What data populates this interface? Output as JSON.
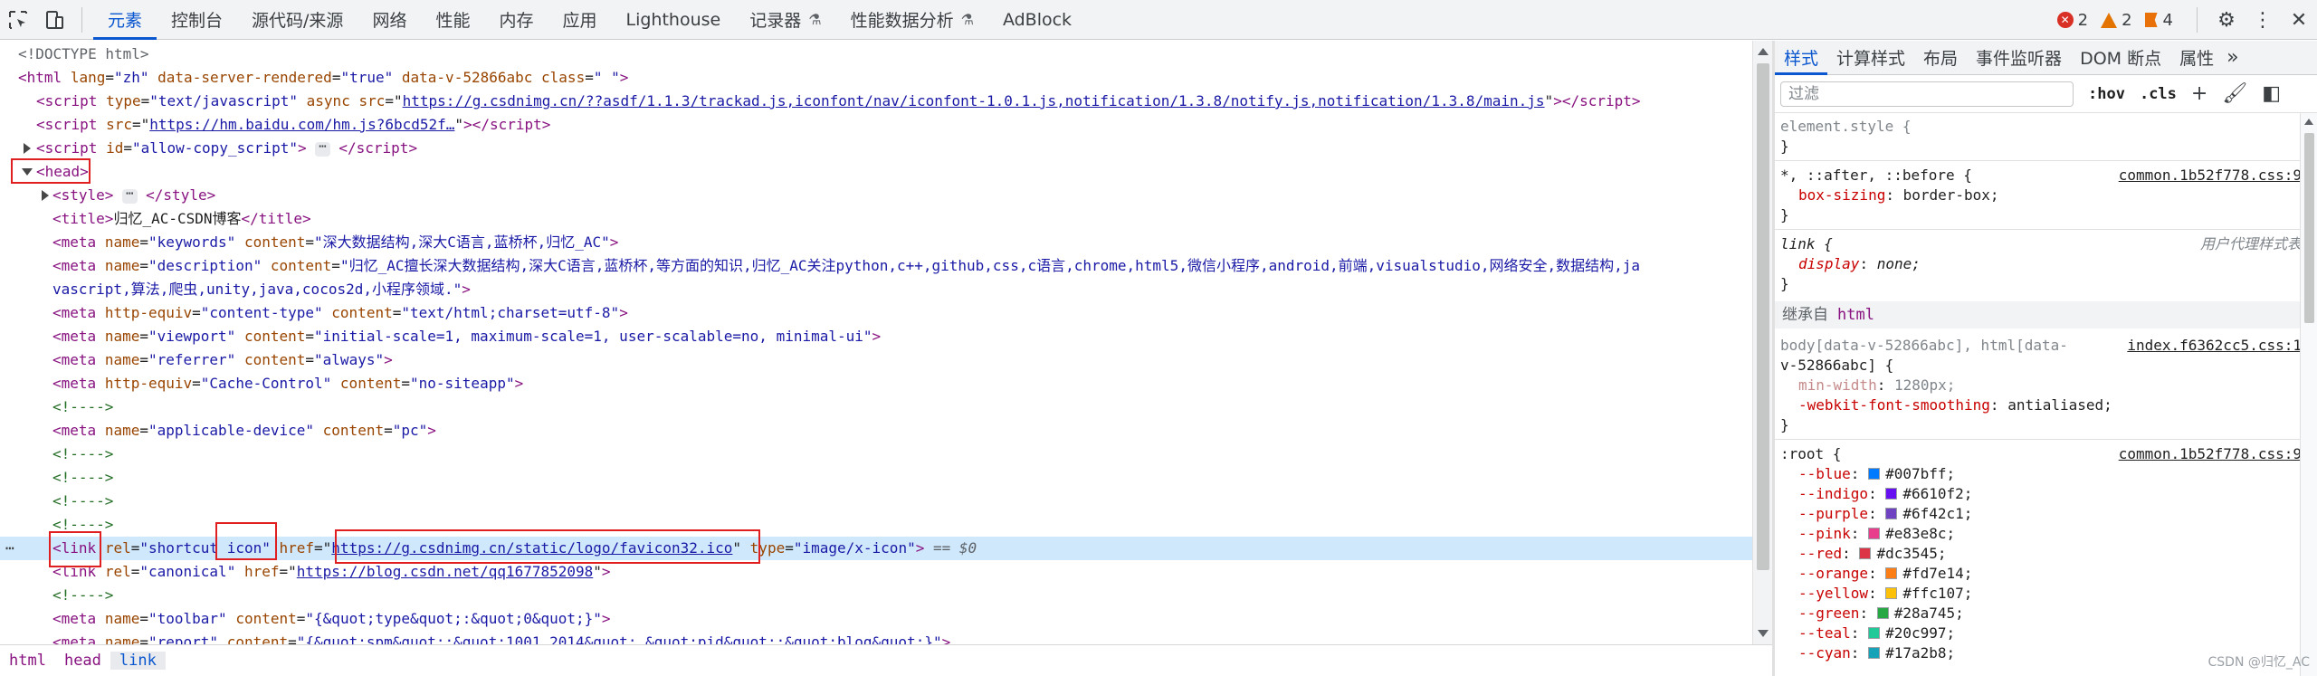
{
  "toolbar": {
    "tabs": [
      "元素",
      "控制台",
      "源代码/来源",
      "网络",
      "性能",
      "内存",
      "应用",
      "Lighthouse",
      "记录器",
      "性能数据分析",
      "AdBlock"
    ],
    "flask_symbol": "⚗",
    "errors": "2",
    "warnings": "2",
    "issues": "4"
  },
  "dom": {
    "l0": "<!DOCTYPE html>",
    "l1_tag": "<html",
    "l1_a1": "lang",
    "l1_v1": "\"zh\"",
    "l1_a2": "data-server-rendered",
    "l1_v2": "\"true\"",
    "l1_a3": "data-v-52866abc",
    "l1_a4": "class",
    "l1_v4": "\" \"",
    "l2_a1": "type",
    "l2_v1": "\"text/javascript\"",
    "l2_a2": "async",
    "l2_a3": "src",
    "l2_url": "https://g.csdnimg.cn/??asdf/1.1.3/trackad.js,iconfont/nav/iconfont-1.0.1.js,notification/1.3.8/notify.js,notification/1.3.8/main.js",
    "l3_url": "https://hm.baidu.com/hm.js?6bcd52f…",
    "l4_a1": "id",
    "l4_v1": "\"allow-copy_script\"",
    "head": "<head>",
    "title_text": "归忆_AC-CSDN博客",
    "kw_name": "\"keywords\"",
    "kw_content": "\"深大数据结构,深大C语言,蓝桥杯,归忆_AC\"",
    "desc_name": "\"description\"",
    "desc_content_1": "\"归忆_AC擅长深大数据结构,深大C语言,蓝桥杯,等方面的知识,归忆_AC关注python,c++,github,css,c语言,chrome,html5,微信小程序,android,前端,visualstudio,网络安全,数据结构,ja",
    "desc_content_2": "vascript,算法,爬虫,unity,java,cocos2d,小程序领域.\"",
    "ct_equiv": "\"content-type\"",
    "ct_content": "\"text/html;charset=utf-8\"",
    "vp_name": "\"viewport\"",
    "vp_content": "\"initial-scale=1, maximum-scale=1, user-scalable=no, minimal-ui\"",
    "ref_name": "\"referrer\"",
    "ref_content": "\"always\"",
    "cc_equiv": "\"Cache-Control\"",
    "cc_content": "\"no-siteapp\"",
    "comment": "<!---->",
    "ad_name": "\"applicable-device\"",
    "ad_content": "\"pc\"",
    "link_rel": "\"shortcut icon\"",
    "link_href": "https://g.csdnimg.cn/static/logo/favicon32.ico",
    "link_type": "\"image/x-icon\"",
    "eq0": "== $0",
    "canon_rel": "\"canonical\"",
    "canon_href": "https://blog.csdn.net/qq1677852098",
    "tb_name": "\"toolbar\"",
    "tb_content": "\"{&quot;type&quot;:&quot;0&quot;}\"",
    "rp_name": "\"report\"",
    "rp_content": "\"{&quot;spm&quot;:&quot;1001.2014&quot;,&quot;pid&quot;:&quot;blog&quot;}\""
  },
  "breadcrumb": [
    "html",
    "head",
    "link"
  ],
  "styles": {
    "tabs": [
      "样式",
      "计算样式",
      "布局",
      "事件监听器",
      "DOM 断点",
      "属性"
    ],
    "filter_placeholder": "过滤",
    "hov": ":hov",
    "cls": ".cls",
    "element_style": "element.style {",
    "rule1_selector": "*, ::after, ::before {",
    "rule1_src": "common.1b52f778.css:9",
    "rule1_prop": "box-sizing",
    "rule1_val": "border-box;",
    "rule2_selector": "link {",
    "rule2_src": "用户代理样式表",
    "rule2_prop": "display",
    "rule2_val": "none;",
    "inherit_label": "继承自",
    "inherit_tag": "html",
    "rule3_sel1": "body[data-v-52866abc], html[data-",
    "rule3_sel2": "v-52866abc] {",
    "rule3_src": "index.f6362cc5.css:1",
    "rule3_p1": "min-width",
    "rule3_v1": "1280px;",
    "rule3_p2": "-webkit-font-smoothing",
    "rule3_v2": "antialiased;",
    "rule4_selector": ":root {",
    "rule4_src": "common.1b52f778.css:9",
    "vars": [
      {
        "name": "--blue",
        "value": "#007bff;",
        "color": "#007bff"
      },
      {
        "name": "--indigo",
        "value": "#6610f2;",
        "color": "#6610f2"
      },
      {
        "name": "--purple",
        "value": "#6f42c1;",
        "color": "#6f42c1"
      },
      {
        "name": "--pink",
        "value": "#e83e8c;",
        "color": "#e83e8c"
      },
      {
        "name": "--red",
        "value": "#dc3545;",
        "color": "#dc3545"
      },
      {
        "name": "--orange",
        "value": "#fd7e14;",
        "color": "#fd7e14"
      },
      {
        "name": "--yellow",
        "value": "#ffc107;",
        "color": "#ffc107"
      },
      {
        "name": "--green",
        "value": "#28a745;",
        "color": "#28a745"
      },
      {
        "name": "--teal",
        "value": "#20c997;",
        "color": "#20c997"
      },
      {
        "name": "--cyan",
        "value": "#17a2b8;",
        "color": "#17a2b8"
      }
    ],
    "close_brace": "}",
    "watermark": "CSDN @归忆_AC"
  },
  "colors": {
    "accent": "#0b57d0",
    "error": "#d93025",
    "warning": "#e37400",
    "issue": "#e8710a",
    "highlight_box": "#e02020"
  }
}
